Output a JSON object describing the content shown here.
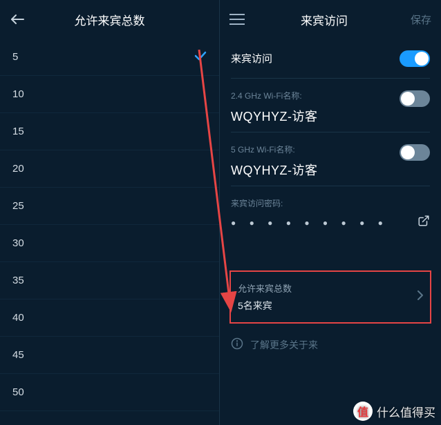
{
  "left": {
    "title": "允许来宾总数",
    "options": [
      "5",
      "10",
      "15",
      "20",
      "25",
      "30",
      "35",
      "40",
      "45",
      "50"
    ],
    "selected": "5"
  },
  "right": {
    "title": "来宾访问",
    "save": "保存",
    "guestAccess": {
      "label": "来宾访问",
      "on": true
    },
    "wifi24": {
      "label": "2.4 GHz Wi-Fi名称:",
      "value": "WQYHYZ-访客",
      "on": false
    },
    "wifi5": {
      "label": "5 GHz Wi-Fi名称:",
      "value": "WQYHYZ-访客",
      "on": false
    },
    "password": {
      "label": "来宾访问密码:",
      "mask": "● ● ● ● ● ● ● ● ●"
    },
    "guestTotal": {
      "label": "允许来宾总数",
      "value": "5名来宾"
    },
    "info": "了解更多关于来"
  },
  "watermark": "什么值得买",
  "watermarkBadge": "值"
}
